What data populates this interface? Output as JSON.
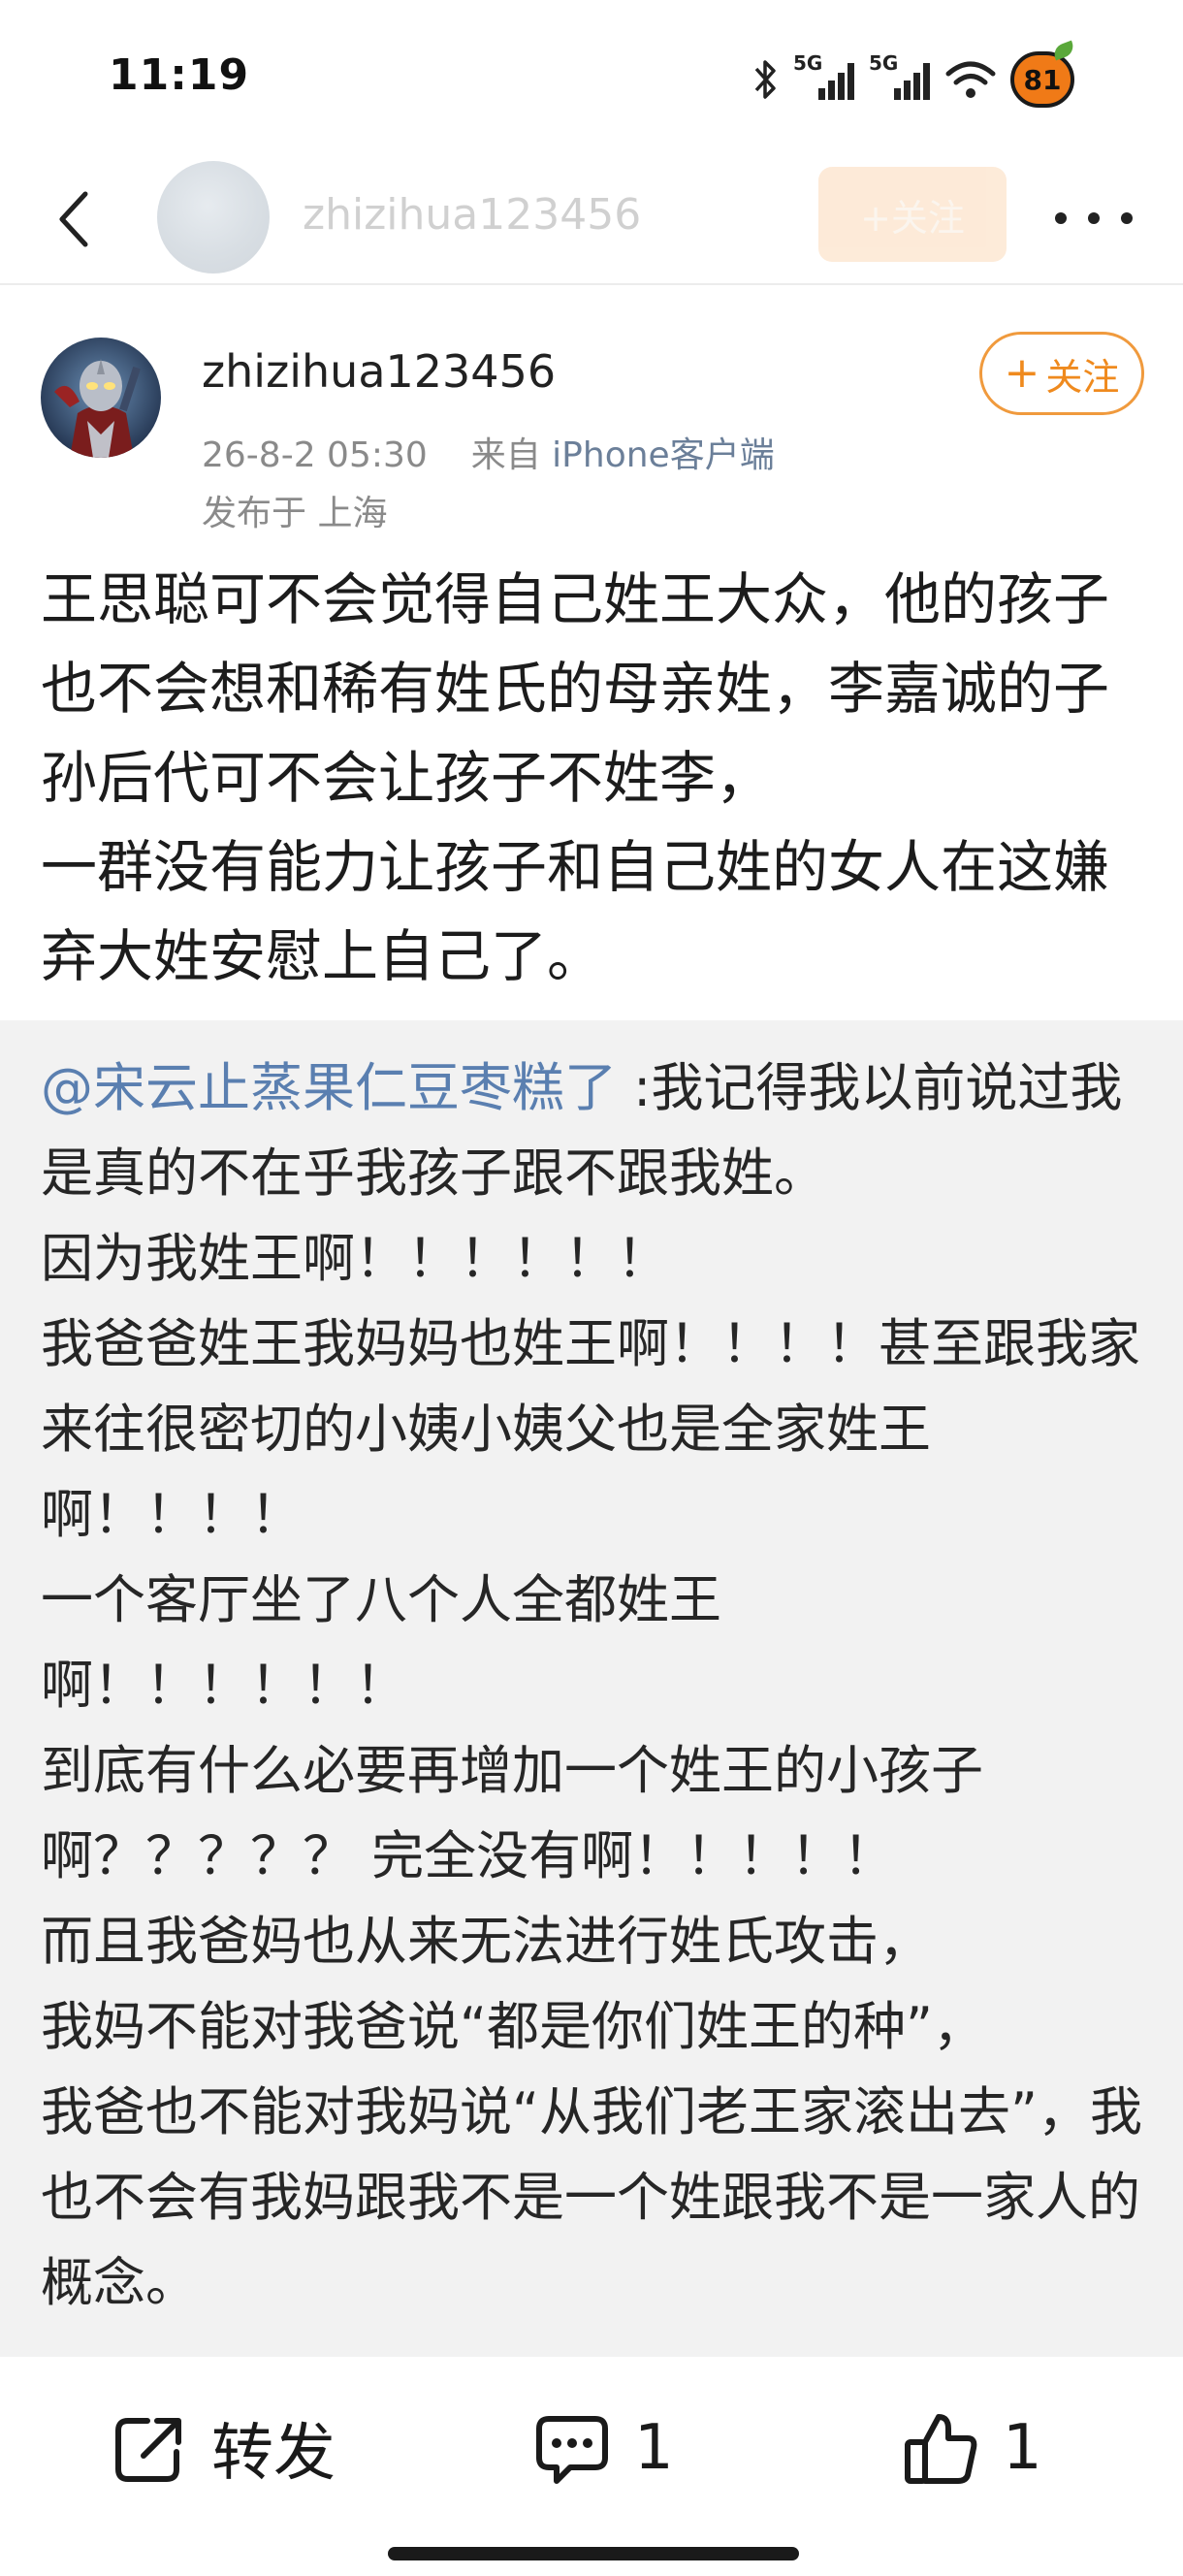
{
  "status_bar": {
    "time": "11:19",
    "network_1": "5G",
    "network_2": "5G",
    "battery": "81",
    "icons": [
      "bluetooth-icon",
      "signal-icon",
      "signal-icon",
      "wifi-icon",
      "battery-icon"
    ]
  },
  "nav": {
    "username": "zhizihua123456",
    "follow_label": "+关注"
  },
  "post": {
    "username": "zhizihua123456",
    "date": "26-8-2 05:30",
    "source_prefix": "来自",
    "source": "iPhone客户端",
    "location": "发布于 上海",
    "follow_plus": "+",
    "follow_label": "关注",
    "body": "王思聪可不会觉得自己姓王大众，他的孩子也不会想和稀有姓氏的母亲姓，李嘉诚的子孙后代可不会让孩子不姓李，\n一群没有能力让孩子和自己姓的女人在这嫌弃大姓安慰上自己了。"
  },
  "quote": {
    "mention": "@宋云止蒸果仁豆枣糕了",
    "text": " :我记得我以前说过我是真的不在乎我孩子跟不跟我姓。\n因为我姓王啊！！！！！！\n我爸爸姓王我妈妈也姓王啊！！！！甚至跟我家来往很密切的小姨小姨父也是全家姓王啊！！！！\n一个客厅坐了八个人全都姓王\n啊！！！！！！\n到底有什么必要再增加一个姓王的小孩子啊？？？？？ 完全没有啊！！！！！\n而且我爸妈也从来无法进行姓氏攻击，\n我妈不能对我爸说“都是你们姓王的种”，\n我爸也不能对我妈说“从我们老王家滚出去”，我也不会有我妈跟我不是一个姓跟我不是一家人的概念。"
  },
  "actions": {
    "repost_label": "转发",
    "comment_count": "1",
    "like_count": "1"
  },
  "colors": {
    "accent_orange": "#ef8a1e",
    "mention_blue": "#5a7fb0",
    "quote_bg": "#f2f2f2"
  }
}
